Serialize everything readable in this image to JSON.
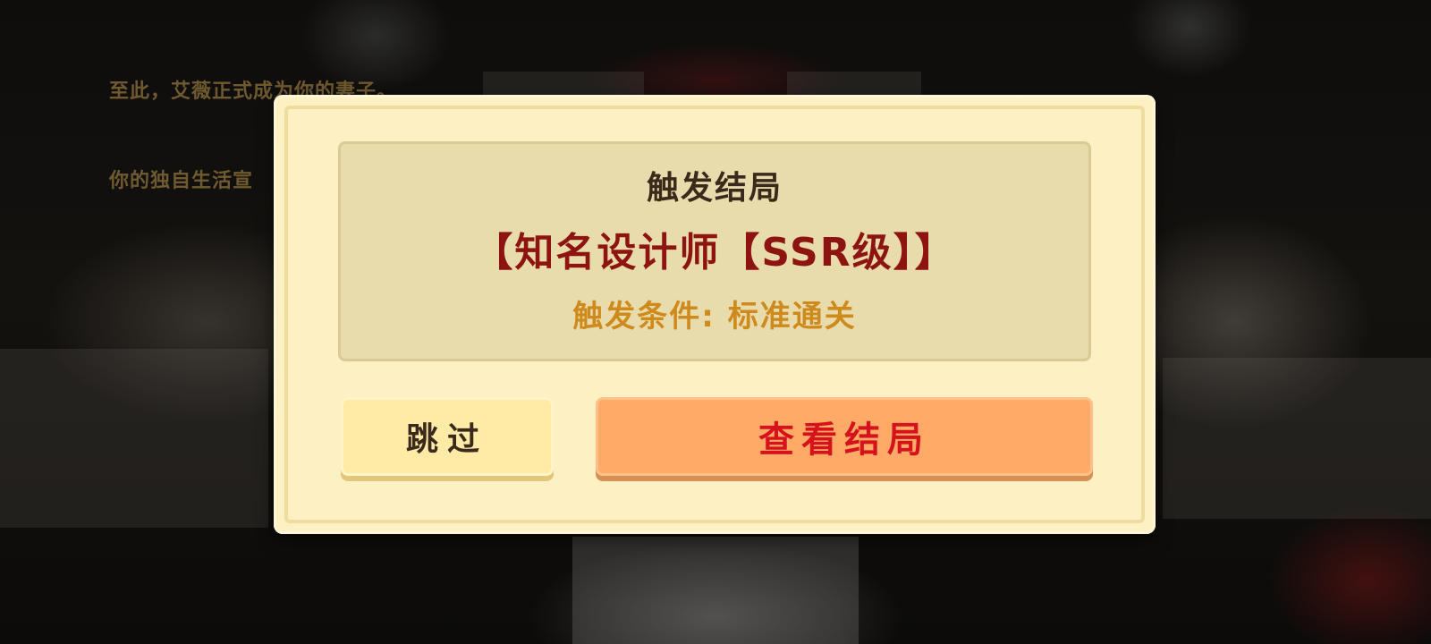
{
  "background": {
    "story_lines": [
      "至此，艾薇正式成为你的妻子。",
      "你的独自生活宣"
    ]
  },
  "dialog": {
    "title": "触发结局",
    "ending_name": "【知名设计师【SSR级】】",
    "condition": "触发条件: 标准通关",
    "skip_label": "跳过",
    "view_label": "查看结局"
  },
  "colors": {
    "dialog_bg": "#fdf0c3",
    "panel_bg": "#e8dcac",
    "ending_name": "#8e1412",
    "condition": "#cf8a1d",
    "skip_button": "#ffeaa6",
    "view_button": "#ffaa66",
    "view_text": "#d6131c"
  }
}
